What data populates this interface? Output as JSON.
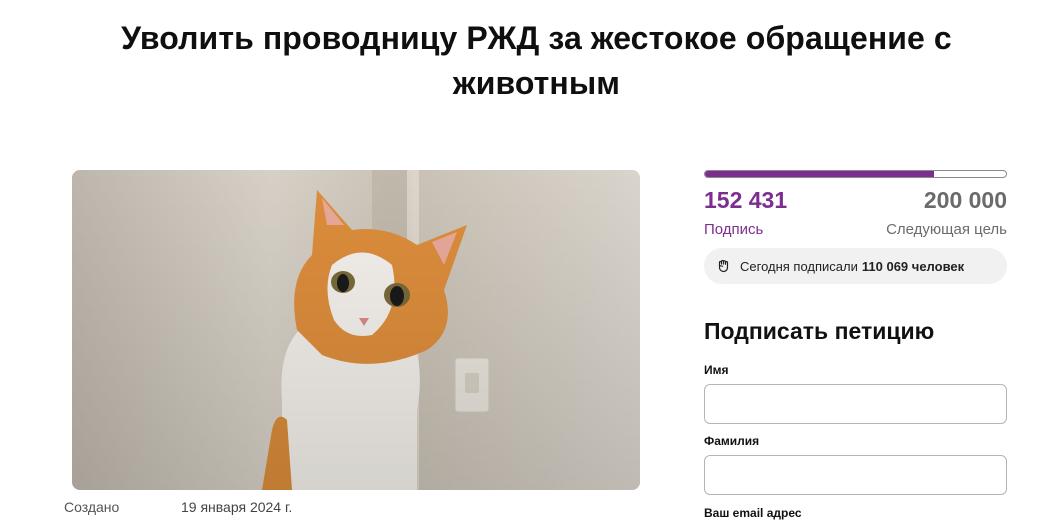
{
  "petition": {
    "title": "Уволить проводницу РЖД за жестокое обращение с животным",
    "created_label": "Создано",
    "created_date": "19 января 2024 г."
  },
  "stats": {
    "signed": "152 431",
    "signed_label": "Подпись",
    "goal": "200 000",
    "goal_label": "Следующая цель",
    "progress_fraction": 0.762,
    "today_text": "Сегодня подписали",
    "today_count": "110 069 человек"
  },
  "form": {
    "title": "Подписать петицию",
    "first_name_label": "Имя",
    "last_name_label": "Фамилия",
    "email_label": "Ваш email адрес"
  },
  "image": {
    "subject": "orange-and-white cat photo"
  },
  "colors": {
    "accent": "#7b2e8e",
    "muted": "#6b6b6b"
  },
  "icons": {
    "today": "raised-fist-icon"
  }
}
